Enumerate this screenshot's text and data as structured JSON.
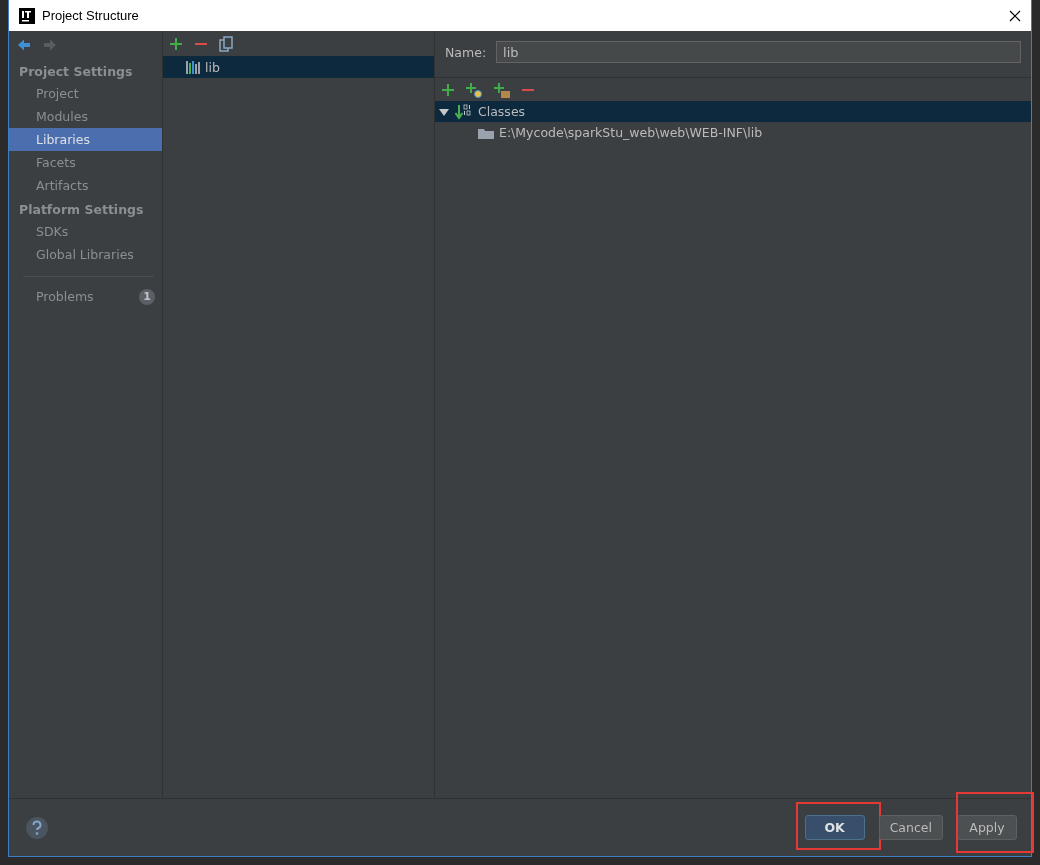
{
  "window": {
    "title": "Project Structure"
  },
  "sidebar": {
    "sections": [
      {
        "title": "Project Settings",
        "items": [
          {
            "label": "Project",
            "selected": false
          },
          {
            "label": "Modules",
            "selected": false
          },
          {
            "label": "Libraries",
            "selected": true
          },
          {
            "label": "Facets",
            "selected": false
          },
          {
            "label": "Artifacts",
            "selected": false
          }
        ]
      },
      {
        "title": "Platform Settings",
        "items": [
          {
            "label": "SDKs",
            "selected": false
          },
          {
            "label": "Global Libraries",
            "selected": false
          }
        ]
      }
    ],
    "problems": {
      "label": "Problems",
      "count": "1"
    }
  },
  "libraries": [
    {
      "label": "lib",
      "selected": true
    }
  ],
  "details": {
    "name_label": "Name:",
    "name_value": "lib",
    "tree": [
      {
        "label": "Classes",
        "expanded": true,
        "selected": true,
        "children": [
          {
            "label": "E:\\Mycode\\sparkStu_web\\web\\WEB-INF\\lib",
            "selected": false
          }
        ]
      }
    ]
  },
  "buttons": [
    {
      "label": "OK",
      "kind": "default",
      "annotated": true
    },
    {
      "label": "Cancel",
      "kind": "normal",
      "annotated": false
    },
    {
      "label": "Apply",
      "kind": "normal",
      "annotated": true
    }
  ]
}
